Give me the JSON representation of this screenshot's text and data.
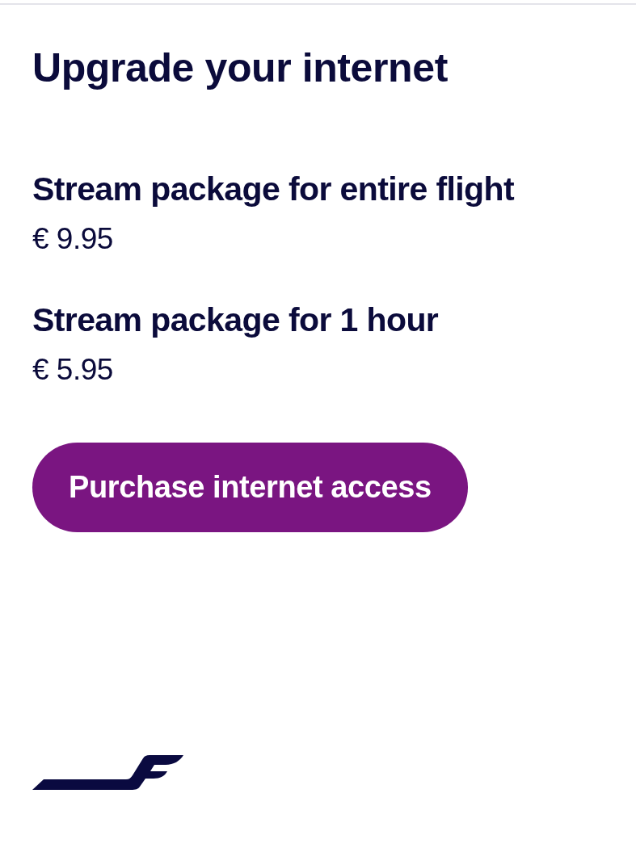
{
  "header": {
    "title": "Upgrade your internet"
  },
  "packages": [
    {
      "name": "Stream package for entire flight",
      "price": "€ 9.95"
    },
    {
      "name": "Stream package for 1 hour",
      "price": "€ 5.95"
    }
  ],
  "purchase_button": {
    "label": "Purchase internet access"
  }
}
